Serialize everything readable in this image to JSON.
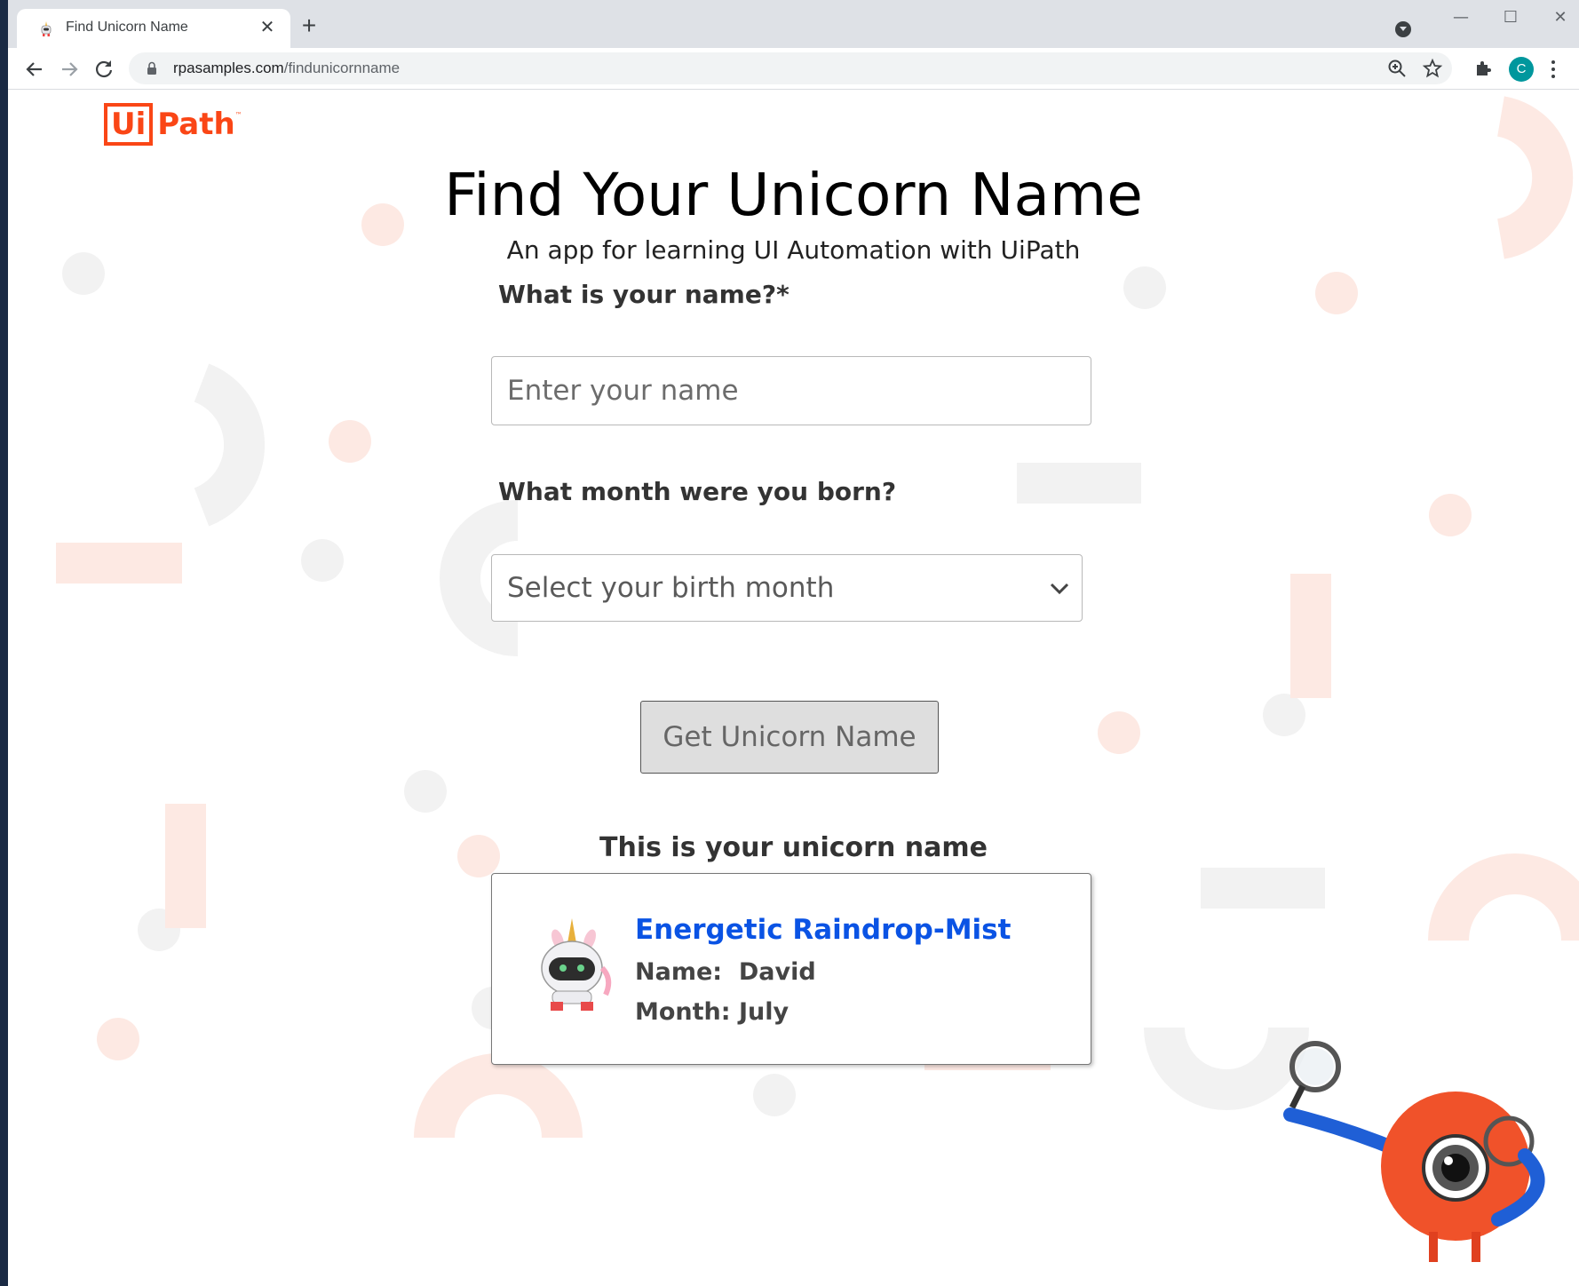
{
  "browser": {
    "tab_title": "Find Unicorn Name",
    "tab_close": "✕",
    "new_tab": "+",
    "url_host": "rpasamples.com",
    "url_path": "/findunicornname",
    "profile_initial": "C",
    "window_controls": {
      "minimize": "—",
      "maximize": "☐",
      "close": "✕"
    }
  },
  "page": {
    "logo_ui": "Ui",
    "logo_path": "Path",
    "logo_tm": "™",
    "title": "Find Your Unicorn Name",
    "subtitle": "An app for learning UI Automation with UiPath",
    "name_label": "What is your name?*",
    "name_placeholder": "Enter your name",
    "month_label": "What month were you born?",
    "month_placeholder": "Select your birth month",
    "button_label": "Get Unicorn Name",
    "result_title": "This is your unicorn name",
    "result": {
      "unicorn_name": "Energetic Raindrop-Mist",
      "name_label": "Name:",
      "name_value": "David",
      "month_label": "Month:",
      "month_value": "July"
    }
  },
  "colors": {
    "brand_orange": "#fa4616",
    "result_link_blue": "#0a53e4",
    "button_bg": "#dedede",
    "deco_pink": "#fde9e3",
    "deco_gray": "#f2f2f2"
  },
  "icons": [
    "unicorn-favicon-icon",
    "close-icon",
    "plus-icon",
    "profile-dropdown-icon",
    "back-arrow-icon",
    "forward-arrow-icon",
    "reload-icon",
    "lock-icon",
    "zoom-icon",
    "star-icon",
    "extensions-icon",
    "kebab-menu-icon",
    "chevron-down-icon",
    "unicorn-robot-icon",
    "magnifier-mascot-icon"
  ]
}
